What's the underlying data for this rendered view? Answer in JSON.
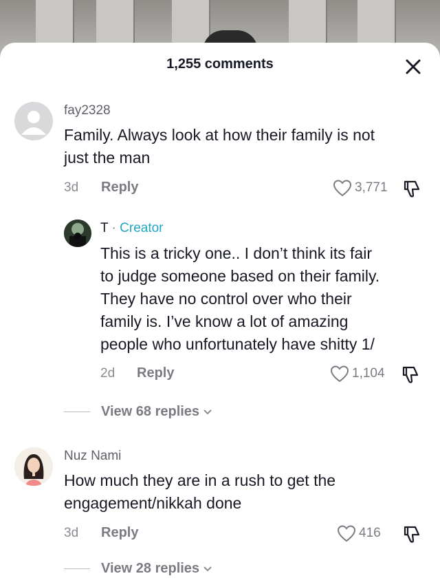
{
  "header": {
    "title": "1,255 comments"
  },
  "comments": [
    {
      "username": "fay2328",
      "text_lines": [
        "Family. Always look at how their family is not",
        "just the man"
      ],
      "time": "3d",
      "reply_label": "Reply",
      "likes": "3,771"
    },
    {
      "username": "T",
      "separator": "·",
      "badge": "Creator",
      "text_lines": [
        "This is a tricky one.. I don’t think its fair",
        "to judge someone based on their family.",
        "They have no control over who their",
        "family is. I’ve know a lot of amazing",
        "people who unfortunately have shitty 1/"
      ],
      "time": "2d",
      "reply_label": "Reply",
      "likes": "1,104"
    },
    {
      "view_replies": "View 68 replies"
    },
    {
      "username": "Nuz Nami",
      "text_lines": [
        "How much they are in a rush to get the",
        "engagement/nikkah done"
      ],
      "time": "3d",
      "reply_label": "Reply",
      "likes": "416",
      "view_replies": "View 28 replies"
    }
  ],
  "colors": {
    "creator": "#20a6c2",
    "text": "#161823",
    "muted": "#8a8b91"
  }
}
